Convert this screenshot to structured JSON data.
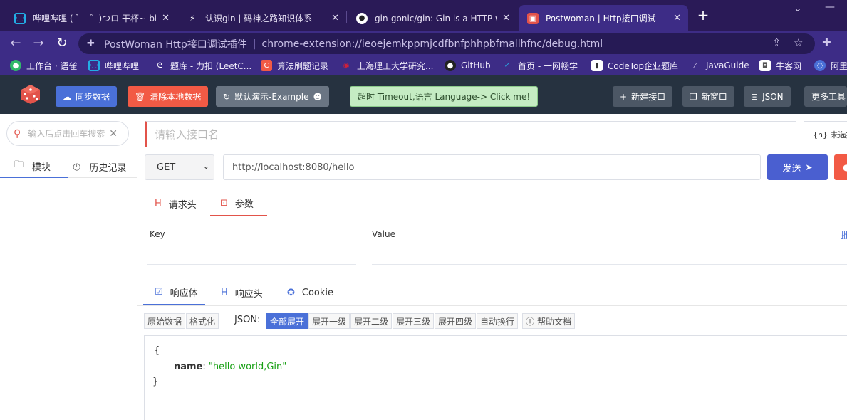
{
  "browser": {
    "tabs": [
      {
        "title": "哔哩哔哩 ( ゜- ゜)つロ 干杯~-bilibili",
        "icon": "bilibili-icon"
      },
      {
        "title": "认识gin | 码神之路知识体系",
        "icon": "mszlu-icon"
      },
      {
        "title": "gin-gonic/gin: Gin is a HTTP web framework",
        "icon": "github-icon"
      },
      {
        "title": "Postwoman | Http接口调试",
        "icon": "postwoman-icon"
      }
    ],
    "omnibox": {
      "site": "PostWoman Http接口调试插件",
      "url": "chrome-extension://ieoejemkppmjcdfbnfphhpbfmallhfnc/debug.html"
    },
    "bookmarks": [
      {
        "label": "工作台 · 语雀",
        "color": "#31b96a"
      },
      {
        "label": "哔哩哔哩",
        "color": "#23ade5"
      },
      {
        "label": "题库 - 力扣 (LeetC...",
        "color": "#3d2c86"
      },
      {
        "label": "算法刷题记录",
        "color": "#f25a45"
      },
      {
        "label": "上海理工大学研究...",
        "color": "#b0102a"
      },
      {
        "label": "GitHub",
        "color": "#222"
      },
      {
        "label": "首页 - 一网畅学",
        "color": "#2aa3e0"
      },
      {
        "label": "CodeTop企业题库",
        "color": "#ffffff"
      },
      {
        "label": "JavaGuide",
        "color": "#3d2c86"
      },
      {
        "label": "牛客网",
        "color": "#ffffff"
      },
      {
        "label": "阿里",
        "color": "#4a70d8"
      }
    ]
  },
  "header": {
    "sync": "同步数据",
    "clear": "清除本地数据",
    "demo": "默认演示-Example",
    "timeout": "超时 Timeout,语言 Language-> Click me!",
    "new_api": "新建接口",
    "new_window": "新窗口",
    "json": "JSON",
    "more_tools": "更多工具"
  },
  "sidebar": {
    "search_placeholder": "输入后点击回车搜索",
    "tabs": [
      {
        "label": "模块"
      },
      {
        "label": "历史记录"
      }
    ]
  },
  "request": {
    "name_placeholder": "请输入接口名",
    "env": "{n} 未选择",
    "method": "GET",
    "url": "http://localhost:8080/hello",
    "send": "发送",
    "tabs": [
      {
        "label": "请求头"
      },
      {
        "label": "参数"
      }
    ],
    "key_label": "Key",
    "value_label": "Value",
    "bulk": "批"
  },
  "response": {
    "tabs": [
      {
        "label": "响应体"
      },
      {
        "label": "响应头"
      },
      {
        "label": "Cookie"
      }
    ],
    "view_buttons": [
      "原始数据",
      "格式化"
    ],
    "json_label": "JSON:",
    "json_buttons": [
      "全部展开",
      "展开一级",
      "展开二级",
      "展开三级",
      "展开四级",
      "自动换行"
    ],
    "help": "帮助文档",
    "body": {
      "open": "{",
      "key": "name",
      "value": "\"hello world,Gin\"",
      "close": "}"
    }
  }
}
